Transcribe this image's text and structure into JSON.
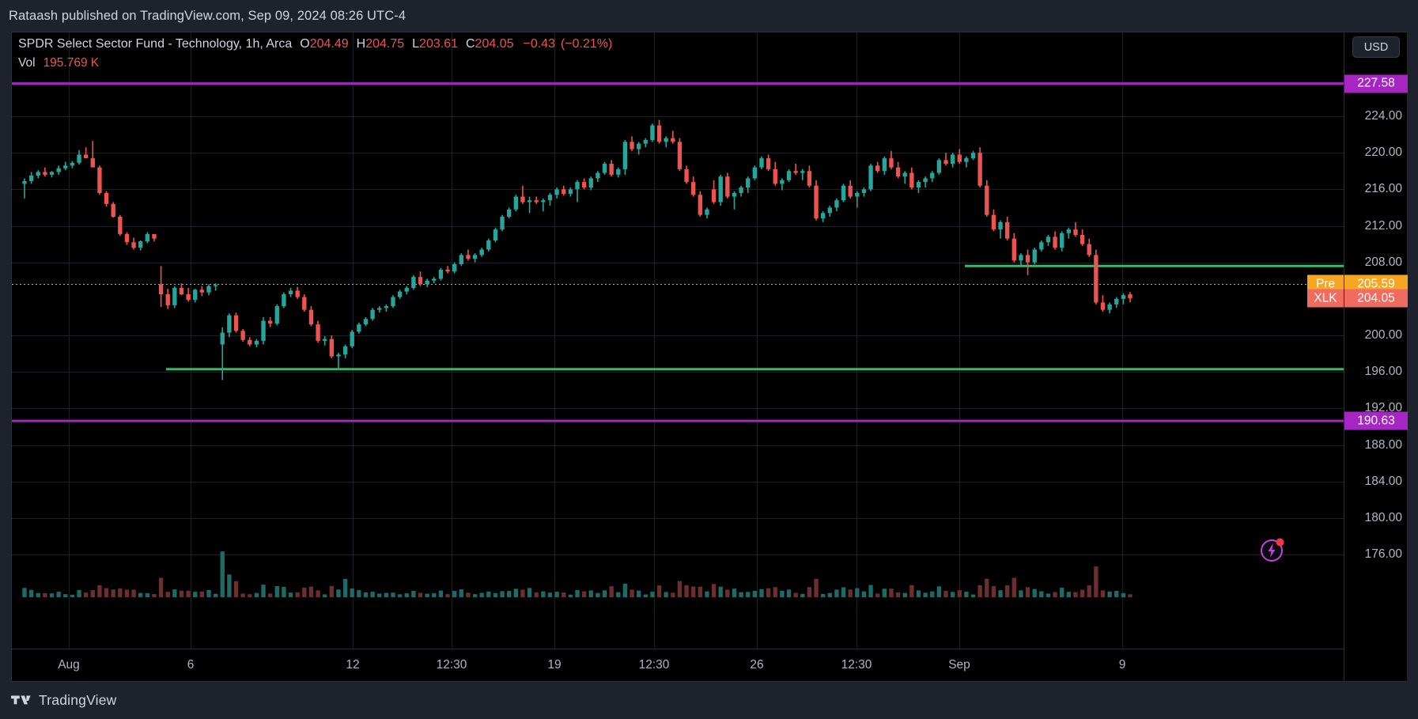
{
  "publisher": {
    "text": "Rataash published on TradingView.com, Sep 09, 2024 08:26 UTC-4"
  },
  "legend": {
    "symbol_title": "SPDR Select Sector Fund - Technology, 1h, Arca",
    "o_label": "O",
    "o_value": "204.49",
    "h_label": "H",
    "h_value": "204.75",
    "l_label": "L",
    "l_value": "203.61",
    "c_label": "C",
    "c_value": "204.05",
    "change": "−0.43",
    "change_pct": "(−0.21%)",
    "volume_label": "Vol",
    "volume_value": "195.769 K",
    "down_color": "#ef5350",
    "text_color": "#d1d4dc"
  },
  "price_scale": {
    "currency_button": "USD",
    "ticks": [
      "224.00",
      "220.00",
      "216.00",
      "212.00",
      "208.00",
      "200.00",
      "196.00",
      "192.00",
      "188.00",
      "184.00",
      "180.00",
      "176.00"
    ],
    "tags": [
      {
        "value": "227.58",
        "style": "magenta"
      },
      {
        "value": "205.59",
        "style": "orange"
      },
      {
        "value": "204.05",
        "style": "red"
      },
      {
        "value": "190.63",
        "style": "magenta"
      }
    ],
    "side_tags": [
      {
        "label": "Pre",
        "style": "orange"
      },
      {
        "label": "XLK",
        "style": "red"
      }
    ]
  },
  "time_axis": {
    "ticks": [
      "Aug",
      "6",
      "12",
      "12:30",
      "19",
      "12:30",
      "26",
      "12:30",
      "Sep",
      "9"
    ]
  },
  "footer": {
    "brand": "TradingView"
  },
  "icons": {
    "bolt": "lightning-bolt-icon",
    "logo": "tradingview-logo-icon"
  },
  "chart_data": {
    "type": "candlestick",
    "title": "SPDR Select Sector Fund - Technology, 1h, Arca",
    "symbol": "XLK",
    "exchange": "Arca",
    "interval": "1h",
    "currency": "USD",
    "xlabel": "",
    "ylabel": "USD",
    "ylim": [
      174.0,
      229.5
    ],
    "grid": true,
    "legend_position": "top-left",
    "x_tick_labels": [
      "Aug",
      "6",
      "12",
      "12:30",
      "19",
      "12:30",
      "26",
      "12:30",
      "Sep",
      "9"
    ],
    "x_tick_positions": [
      72,
      226,
      431,
      556,
      686,
      812,
      942,
      1068,
      1198,
      1404
    ],
    "y_tick_values": [
      224,
      220,
      216,
      212,
      208,
      200,
      196,
      192,
      188,
      184,
      180,
      176
    ],
    "up_color": "#26a69a",
    "down_color": "#ef5350",
    "last_ohlc": {
      "open": 204.49,
      "high": 204.75,
      "low": 203.61,
      "close": 204.05,
      "change": -0.43,
      "change_pct": -0.21
    },
    "volume_last": "195.769 K",
    "horizontal_lines": [
      {
        "price": 227.58,
        "color": "#a626c4",
        "width": 3,
        "label": "227.58",
        "span": "full"
      },
      {
        "price": 190.63,
        "color": "#a626c4",
        "width": 3,
        "label": "190.63",
        "span": "full"
      },
      {
        "price": 205.59,
        "color": "#f5a623",
        "width": 1,
        "style": "dotted",
        "label": "205.59",
        "span": "full"
      },
      {
        "price": 196.3,
        "color": "#22c55e",
        "width": 3,
        "label": "",
        "span": "partial-right-from-x-195"
      },
      {
        "price": 207.6,
        "color": "#22c55e",
        "width": 3,
        "label": "",
        "span": "partial-right-from-x-1205"
      }
    ],
    "ohlc": [
      [
        216.6,
        217.2,
        215.0,
        216.9
      ],
      [
        216.9,
        217.9,
        216.6,
        217.5
      ],
      [
        217.5,
        218.1,
        217.2,
        217.9
      ],
      [
        217.9,
        218.4,
        217.4,
        217.6
      ],
      [
        217.6,
        218.0,
        217.3,
        217.9
      ],
      [
        217.9,
        218.6,
        217.6,
        218.3
      ],
      [
        218.3,
        219.0,
        218.1,
        218.6
      ],
      [
        218.6,
        219.1,
        218.3,
        218.9
      ],
      [
        218.9,
        220.3,
        218.7,
        219.8
      ],
      [
        219.8,
        220.6,
        219.4,
        219.4
      ],
      [
        219.4,
        221.3,
        218.5,
        218.4
      ],
      [
        218.4,
        218.6,
        215.4,
        215.6
      ],
      [
        215.6,
        215.8,
        214.1,
        214.4
      ],
      [
        214.4,
        214.6,
        212.9,
        213.0
      ],
      [
        213.0,
        213.2,
        210.9,
        211.1
      ],
      [
        211.1,
        211.3,
        209.9,
        210.2
      ],
      [
        210.2,
        210.7,
        209.4,
        209.6
      ],
      [
        209.6,
        210.4,
        209.3,
        210.3
      ],
      [
        210.3,
        211.3,
        210.1,
        211.1
      ],
      [
        211.1,
        211.0,
        210.3,
        210.6
      ],
      [
        205.6,
        207.6,
        203.1,
        204.5
      ],
      [
        204.5,
        205.1,
        202.9,
        203.3
      ],
      [
        203.3,
        205.4,
        203.0,
        205.2
      ],
      [
        205.2,
        205.7,
        204.4,
        204.5
      ],
      [
        204.5,
        205.2,
        203.7,
        203.9
      ],
      [
        203.9,
        205.1,
        203.6,
        205.0
      ],
      [
        205.0,
        205.4,
        204.3,
        204.7
      ],
      [
        204.7,
        205.6,
        204.4,
        205.4
      ],
      [
        205.4,
        205.7,
        204.9,
        205.5
      ],
      [
        199.0,
        200.9,
        195.1,
        200.3
      ],
      [
        200.3,
        202.4,
        199.8,
        202.2
      ],
      [
        202.2,
        202.5,
        200.3,
        200.5
      ],
      [
        200.5,
        200.7,
        199.3,
        199.5
      ],
      [
        199.5,
        199.8,
        198.8,
        199.0
      ],
      [
        199.0,
        199.6,
        198.7,
        199.4
      ],
      [
        199.4,
        202.0,
        199.0,
        201.6
      ],
      [
        201.6,
        202.0,
        200.9,
        201.3
      ],
      [
        201.3,
        203.4,
        201.1,
        203.2
      ],
      [
        203.2,
        204.7,
        203.0,
        204.5
      ],
      [
        204.5,
        205.2,
        204.2,
        204.9
      ],
      [
        204.9,
        205.3,
        204.0,
        204.2
      ],
      [
        204.2,
        204.5,
        202.6,
        202.8
      ],
      [
        202.8,
        203.2,
        201.0,
        201.2
      ],
      [
        201.2,
        201.6,
        199.2,
        199.4
      ],
      [
        199.4,
        199.9,
        198.9,
        199.6
      ],
      [
        199.6,
        200.0,
        197.5,
        197.7
      ],
      [
        197.7,
        198.1,
        196.2,
        197.9
      ],
      [
        197.9,
        199.0,
        197.5,
        198.8
      ],
      [
        198.8,
        200.6,
        198.6,
        200.4
      ],
      [
        200.4,
        201.4,
        200.2,
        201.2
      ],
      [
        201.2,
        202.0,
        201.0,
        201.8
      ],
      [
        201.8,
        203.0,
        201.6,
        202.8
      ],
      [
        202.8,
        203.2,
        202.5,
        203.0
      ],
      [
        203.0,
        203.4,
        202.6,
        203.2
      ],
      [
        203.2,
        204.4,
        203.0,
        204.2
      ],
      [
        204.2,
        205.0,
        204.0,
        204.8
      ],
      [
        204.8,
        205.4,
        204.5,
        205.2
      ],
      [
        205.2,
        206.6,
        205.0,
        206.4
      ],
      [
        206.4,
        207.0,
        205.4,
        205.6
      ],
      [
        205.6,
        206.2,
        205.3,
        206.0
      ],
      [
        206.0,
        206.4,
        205.7,
        206.2
      ],
      [
        206.2,
        207.4,
        206.0,
        207.2
      ],
      [
        207.2,
        207.6,
        206.8,
        207.0
      ],
      [
        207.0,
        208.0,
        206.8,
        207.8
      ],
      [
        207.8,
        209.0,
        207.6,
        208.8
      ],
      [
        208.8,
        209.4,
        208.2,
        208.4
      ],
      [
        208.4,
        209.0,
        208.0,
        208.8
      ],
      [
        208.8,
        209.6,
        208.6,
        209.4
      ],
      [
        209.4,
        210.6,
        209.2,
        210.4
      ],
      [
        210.4,
        211.8,
        210.2,
        211.6
      ],
      [
        211.6,
        213.2,
        211.4,
        213.0
      ],
      [
        213.0,
        214.0,
        212.8,
        213.8
      ],
      [
        213.8,
        215.4,
        213.6,
        215.2
      ],
      [
        215.2,
        216.4,
        214.4,
        214.6
      ],
      [
        214.6,
        215.2,
        213.4,
        214.8
      ],
      [
        214.8,
        215.2,
        214.4,
        214.6
      ],
      [
        214.6,
        215.0,
        213.6,
        214.8
      ],
      [
        214.8,
        215.6,
        214.2,
        215.4
      ],
      [
        215.4,
        216.2,
        215.0,
        216.0
      ],
      [
        216.0,
        216.4,
        215.3,
        215.5
      ],
      [
        215.5,
        216.2,
        215.2,
        216.0
      ],
      [
        216.0,
        217.0,
        214.6,
        216.8
      ],
      [
        216.8,
        217.2,
        216.0,
        216.2
      ],
      [
        216.2,
        217.4,
        215.9,
        217.2
      ],
      [
        217.2,
        218.0,
        216.8,
        217.8
      ],
      [
        217.8,
        219.0,
        217.6,
        218.8
      ],
      [
        218.8,
        219.2,
        217.4,
        217.6
      ],
      [
        217.6,
        218.4,
        217.3,
        218.2
      ],
      [
        218.2,
        221.4,
        217.6,
        221.2
      ],
      [
        221.2,
        221.8,
        220.2,
        220.4
      ],
      [
        220.4,
        221.2,
        219.8,
        221.0
      ],
      [
        221.0,
        221.6,
        220.6,
        221.4
      ],
      [
        221.4,
        223.2,
        221.2,
        223.0
      ],
      [
        223.0,
        223.6,
        221.0,
        221.2
      ],
      [
        221.2,
        221.8,
        220.6,
        221.6
      ],
      [
        221.6,
        222.4,
        221.0,
        221.2
      ],
      [
        221.2,
        221.6,
        218.0,
        218.2
      ],
      [
        218.2,
        218.6,
        216.6,
        216.8
      ],
      [
        216.8,
        217.4,
        215.2,
        215.4
      ],
      [
        215.4,
        215.8,
        213.0,
        213.2
      ],
      [
        213.2,
        214.0,
        212.8,
        213.8
      ],
      [
        216.0,
        217.0,
        214.4,
        214.6
      ],
      [
        214.6,
        217.6,
        214.2,
        217.4
      ],
      [
        217.4,
        217.8,
        215.0,
        215.2
      ],
      [
        215.2,
        215.8,
        213.8,
        215.6
      ],
      [
        215.6,
        216.4,
        215.2,
        216.2
      ],
      [
        216.2,
        217.4,
        215.6,
        217.2
      ],
      [
        217.2,
        218.6,
        217.0,
        218.4
      ],
      [
        218.4,
        219.6,
        218.2,
        219.4
      ],
      [
        219.4,
        219.8,
        218.0,
        218.2
      ],
      [
        218.2,
        219.0,
        216.4,
        216.6
      ],
      [
        216.6,
        217.2,
        215.9,
        217.0
      ],
      [
        217.0,
        218.2,
        216.8,
        218.0
      ],
      [
        218.0,
        218.8,
        217.6,
        217.8
      ],
      [
        217.8,
        218.2,
        217.0,
        218.0
      ],
      [
        218.0,
        218.6,
        216.2,
        216.4
      ],
      [
        216.4,
        217.0,
        212.6,
        212.8
      ],
      [
        212.8,
        213.6,
        212.4,
        213.4
      ],
      [
        213.4,
        214.2,
        213.0,
        214.0
      ],
      [
        214.0,
        215.0,
        213.6,
        214.8
      ],
      [
        214.8,
        216.6,
        214.6,
        216.4
      ],
      [
        216.4,
        217.0,
        215.0,
        215.2
      ],
      [
        215.2,
        215.8,
        214.0,
        215.6
      ],
      [
        215.6,
        216.2,
        215.2,
        216.0
      ],
      [
        216.0,
        218.8,
        215.8,
        218.6
      ],
      [
        218.6,
        219.0,
        217.8,
        218.0
      ],
      [
        218.0,
        219.6,
        217.6,
        219.4
      ],
      [
        219.4,
        220.2,
        218.2,
        218.4
      ],
      [
        218.4,
        219.0,
        217.2,
        217.4
      ],
      [
        217.4,
        218.0,
        216.6,
        217.8
      ],
      [
        217.8,
        218.4,
        216.0,
        216.2
      ],
      [
        216.2,
        217.0,
        215.6,
        216.8
      ],
      [
        216.8,
        217.4,
        216.2,
        217.2
      ],
      [
        217.2,
        218.0,
        216.8,
        217.8
      ],
      [
        217.8,
        219.4,
        217.6,
        219.2
      ],
      [
        219.2,
        220.0,
        218.6,
        218.8
      ],
      [
        218.8,
        220.0,
        218.4,
        219.8
      ],
      [
        219.8,
        220.4,
        218.8,
        219.0
      ],
      [
        219.0,
        219.6,
        218.4,
        219.4
      ],
      [
        219.4,
        220.2,
        219.2,
        220.0
      ],
      [
        220.0,
        220.6,
        216.2,
        216.4
      ],
      [
        216.4,
        217.0,
        213.0,
        213.2
      ],
      [
        213.2,
        213.8,
        211.4,
        211.6
      ],
      [
        211.6,
        212.6,
        210.6,
        212.4
      ],
      [
        212.4,
        213.0,
        210.4,
        210.6
      ],
      [
        210.6,
        211.2,
        208.0,
        208.2
      ],
      [
        208.2,
        209.0,
        207.6,
        208.8
      ],
      [
        208.8,
        209.4,
        206.6,
        208.0
      ],
      [
        208.0,
        209.6,
        207.8,
        209.4
      ],
      [
        209.4,
        210.4,
        209.2,
        210.2
      ],
      [
        210.2,
        211.0,
        209.8,
        210.8
      ],
      [
        210.8,
        211.4,
        209.4,
        209.6
      ],
      [
        209.6,
        211.4,
        209.2,
        211.2
      ],
      [
        211.2,
        211.8,
        210.6,
        211.6
      ],
      [
        211.6,
        212.4,
        210.8,
        211.0
      ],
      [
        211.0,
        211.6,
        209.8,
        210.0
      ],
      [
        210.0,
        210.6,
        208.6,
        208.8
      ],
      [
        208.8,
        209.4,
        203.4,
        203.6
      ],
      [
        203.6,
        204.4,
        202.6,
        202.8
      ],
      [
        202.8,
        203.6,
        202.4,
        203.4
      ],
      [
        203.4,
        204.2,
        203.0,
        204.0
      ],
      [
        204.0,
        204.6,
        203.4,
        204.4
      ],
      [
        204.49,
        204.75,
        203.61,
        204.05
      ]
    ],
    "volume_note": "Volume histogram rendered below price panel, same bar spacing"
  }
}
